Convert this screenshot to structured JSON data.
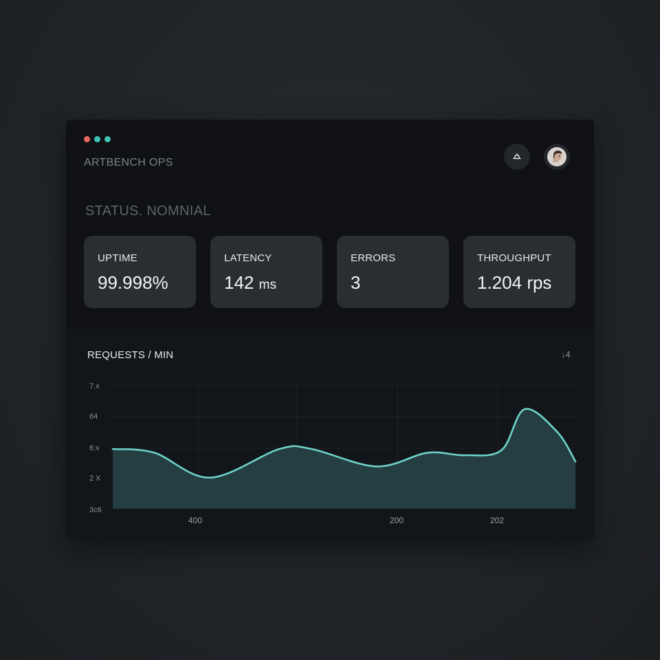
{
  "window": {
    "app_title": "ARTBENCH OPS",
    "traffic_lights": [
      "#e8675c",
      "#3fc4b4",
      "#3fc4b4"
    ]
  },
  "header": {
    "notification_icon": "bell-icon",
    "avatar_icon": "user-avatar"
  },
  "status_text": "STATUS. NOMNIAL",
  "metrics": [
    {
      "label": "UPTIME",
      "value": "99.998%",
      "unit": ""
    },
    {
      "label": "LATENCY",
      "value": "142",
      "unit": "ms"
    },
    {
      "label": "ERRORS",
      "value": "3",
      "unit": ""
    },
    {
      "label": "THROUGHPUT",
      "value": "1.204",
      "unit": "rps"
    }
  ],
  "chart": {
    "title": "REQUESTS / MIN",
    "toggle_label": "↓4",
    "accent": "#6fd4cc",
    "fill": "#274043"
  },
  "chart_data": {
    "type": "area",
    "title": "REQUESTS / MIN",
    "y_tick_labels": [
      "7.x",
      "64",
      "6:x",
      "2 X",
      "3c6"
    ],
    "x_tick_labels": [
      "400",
      "200",
      "202"
    ],
    "x": [
      0,
      0.09,
      0.21,
      0.36,
      0.43,
      0.57,
      0.68,
      0.76,
      0.84,
      0.89,
      0.96,
      1.0
    ],
    "values": [
      0.48,
      0.45,
      0.25,
      0.48,
      0.48,
      0.34,
      0.45,
      0.43,
      0.47,
      0.8,
      0.62,
      0.38
    ],
    "ylim": [
      0,
      1
    ],
    "grid": true,
    "legend": "none"
  }
}
